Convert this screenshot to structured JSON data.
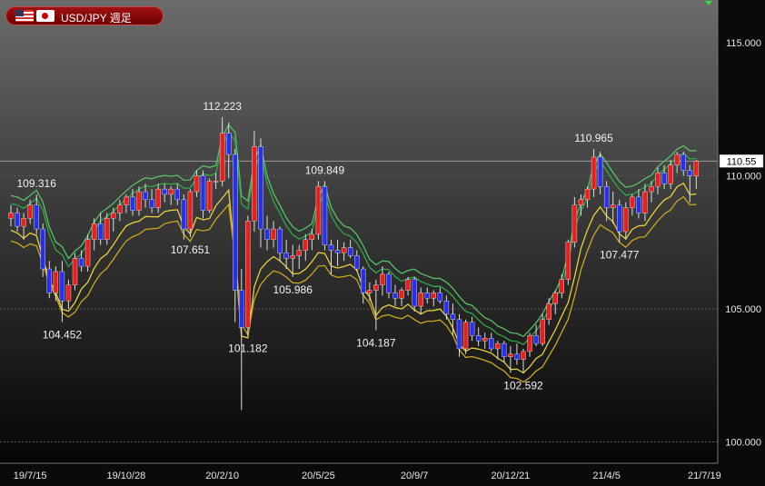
{
  "header": {
    "pair_label": "USD/JPY 週足"
  },
  "colors": {
    "up": "#ee1d1d",
    "down": "#2a2ef0",
    "ma_fast": "#e8d13a",
    "ma_slow": "#caa81e",
    "band_upper": "#2fa84a",
    "band_upper_light": "#58c067",
    "price_line": "#9a9a9a",
    "grid": "#5a5a5a"
  },
  "chart_data": {
    "type": "candlestick",
    "title": "USD/JPY 週足",
    "ylim": [
      99.2,
      116.6
    ],
    "y_ticks": [
      "115.000",
      "110.000",
      "105.000",
      "100.000"
    ],
    "x_labels": [
      {
        "label": "19/7/15",
        "index": 3
      },
      {
        "label": "19/10/28",
        "index": 18
      },
      {
        "label": "20/2/10",
        "index": 33
      },
      {
        "label": "20/5/25",
        "index": 48
      },
      {
        "label": "20/9/7",
        "index": 63
      },
      {
        "label": "20/12/21",
        "index": 78
      },
      {
        "label": "21/4/5",
        "index": 93
      },
      {
        "label": "21/7/19",
        "index": 108
      }
    ],
    "current_price": "110.55",
    "annotations": [
      {
        "text": "109.316",
        "index": 4,
        "value": 109.316,
        "pos": "above"
      },
      {
        "text": "104.452",
        "index": 8,
        "value": 104.452,
        "pos": "below"
      },
      {
        "text": "112.223",
        "index": 33,
        "value": 112.223,
        "pos": "above"
      },
      {
        "text": "107.651",
        "index": 28,
        "value": 107.651,
        "pos": "below"
      },
      {
        "text": "101.182",
        "index": 37,
        "value": 101.182,
        "pos": "below"
      },
      {
        "text": "109.849",
        "index": 49,
        "value": 109.849,
        "pos": "above"
      },
      {
        "text": "105.986",
        "index": 44,
        "value": 105.986,
        "pos": "below"
      },
      {
        "text": "104.187",
        "index": 57,
        "value": 104.187,
        "pos": "below"
      },
      {
        "text": "102.592",
        "index": 80,
        "value": 102.592,
        "pos": "below"
      },
      {
        "text": "110.965",
        "index": 91,
        "value": 110.965,
        "pos": "above"
      },
      {
        "text": "107.477",
        "index": 95,
        "value": 107.477,
        "pos": "below"
      }
    ],
    "candles": [
      [
        108.4,
        108.9,
        108.1,
        108.6
      ],
      [
        108.6,
        108.8,
        107.9,
        108.1
      ],
      [
        108.1,
        108.6,
        107.6,
        108.4
      ],
      [
        108.4,
        109.1,
        108.2,
        108.9
      ],
      [
        108.9,
        109.3,
        107.8,
        108.0
      ],
      [
        108.0,
        108.2,
        106.2,
        106.5
      ],
      [
        106.5,
        106.8,
        105.4,
        105.6
      ],
      [
        105.6,
        106.6,
        105.3,
        106.4
      ],
      [
        106.4,
        106.8,
        104.5,
        105.3
      ],
      [
        105.3,
        106.1,
        105.0,
        105.9
      ],
      [
        105.9,
        107.1,
        105.7,
        106.9
      ],
      [
        106.9,
        107.2,
        106.4,
        106.6
      ],
      [
        106.6,
        107.8,
        106.4,
        107.6
      ],
      [
        107.6,
        108.4,
        107.2,
        108.2
      ],
      [
        108.2,
        108.6,
        107.4,
        107.6
      ],
      [
        107.6,
        108.6,
        107.4,
        108.4
      ],
      [
        108.4,
        108.8,
        107.9,
        108.6
      ],
      [
        108.6,
        109.1,
        108.3,
        108.9
      ],
      [
        108.9,
        109.3,
        108.6,
        109.2
      ],
      [
        109.2,
        109.5,
        108.5,
        108.7
      ],
      [
        108.7,
        109.6,
        108.5,
        109.4
      ],
      [
        109.4,
        109.7,
        108.8,
        109.1
      ],
      [
        109.1,
        109.5,
        108.6,
        108.8
      ],
      [
        108.8,
        109.7,
        108.6,
        109.5
      ],
      [
        109.5,
        109.7,
        109.0,
        109.3
      ],
      [
        109.3,
        109.6,
        108.9,
        109.5
      ],
      [
        109.5,
        109.7,
        108.9,
        109.1
      ],
      [
        109.1,
        109.3,
        107.6,
        108.0
      ],
      [
        108.0,
        109.5,
        107.7,
        109.4
      ],
      [
        109.4,
        110.2,
        109.2,
        110.0
      ],
      [
        110.0,
        110.2,
        108.4,
        108.7
      ],
      [
        108.7,
        109.9,
        108.6,
        109.8
      ],
      [
        109.8,
        110.1,
        109.5,
        109.8
      ],
      [
        109.8,
        112.2,
        109.6,
        111.6
      ],
      [
        111.6,
        112.0,
        109.9,
        110.8
      ],
      [
        110.8,
        111.0,
        104.5,
        105.7
      ],
      [
        105.7,
        106.5,
        101.2,
        104.3
      ],
      [
        104.3,
        108.5,
        104.0,
        108.3
      ],
      [
        108.3,
        111.7,
        107.9,
        111.1
      ],
      [
        111.1,
        111.4,
        107.3,
        108.0
      ],
      [
        108.0,
        108.5,
        107.2,
        107.6
      ],
      [
        107.6,
        108.3,
        107.3,
        108.0
      ],
      [
        108.0,
        108.1,
        106.8,
        107.1
      ],
      [
        107.1,
        107.6,
        106.5,
        106.9
      ],
      [
        106.9,
        107.4,
        106.2,
        107.0
      ],
      [
        107.0,
        107.4,
        106.5,
        107.2
      ],
      [
        107.2,
        107.8,
        106.8,
        107.6
      ],
      [
        107.6,
        108.0,
        107.2,
        107.8
      ],
      [
        107.8,
        109.8,
        107.6,
        109.6
      ],
      [
        109.6,
        109.8,
        107.2,
        107.4
      ],
      [
        107.4,
        107.6,
        106.3,
        107.2
      ],
      [
        107.2,
        107.6,
        106.6,
        107.1
      ],
      [
        107.1,
        107.5,
        106.8,
        107.3
      ],
      [
        107.3,
        107.6,
        106.9,
        107.0
      ],
      [
        107.0,
        107.2,
        106.4,
        106.5
      ],
      [
        106.5,
        106.6,
        105.2,
        105.6
      ],
      [
        105.6,
        106.0,
        105.3,
        105.7
      ],
      [
        105.7,
        106.1,
        104.2,
        105.9
      ],
      [
        105.9,
        106.6,
        105.5,
        106.3
      ],
      [
        106.3,
        106.4,
        105.4,
        105.6
      ],
      [
        105.6,
        105.9,
        105.1,
        105.4
      ],
      [
        105.4,
        105.8,
        105.1,
        105.7
      ],
      [
        105.7,
        106.2,
        105.5,
        106.1
      ],
      [
        106.1,
        106.2,
        104.9,
        105.1
      ],
      [
        105.1,
        105.8,
        104.8,
        105.6
      ],
      [
        105.6,
        105.8,
        105.2,
        105.4
      ],
      [
        105.4,
        105.7,
        105.1,
        105.6
      ],
      [
        105.6,
        105.8,
        105.2,
        105.3
      ],
      [
        105.3,
        105.5,
        104.6,
        104.8
      ],
      [
        104.8,
        105.2,
        104.0,
        104.6
      ],
      [
        104.6,
        104.8,
        103.2,
        103.5
      ],
      [
        103.5,
        104.6,
        103.3,
        104.5
      ],
      [
        104.5,
        104.7,
        103.8,
        104.0
      ],
      [
        104.0,
        104.3,
        103.6,
        103.8
      ],
      [
        103.8,
        104.1,
        103.5,
        103.9
      ],
      [
        103.9,
        104.1,
        103.4,
        103.5
      ],
      [
        103.5,
        103.8,
        103.1,
        103.7
      ],
      [
        103.7,
        103.8,
        103.0,
        103.2
      ],
      [
        103.2,
        103.6,
        102.6,
        103.3
      ],
      [
        103.3,
        103.7,
        102.9,
        103.1
      ],
      [
        103.1,
        103.5,
        102.6,
        103.4
      ],
      [
        103.4,
        104.1,
        103.2,
        104.0
      ],
      [
        104.0,
        104.4,
        103.6,
        103.7
      ],
      [
        103.7,
        104.8,
        103.6,
        104.6
      ],
      [
        104.6,
        105.4,
        104.4,
        105.2
      ],
      [
        105.2,
        105.7,
        104.8,
        105.6
      ],
      [
        105.6,
        106.3,
        105.4,
        106.1
      ],
      [
        106.1,
        107.6,
        105.9,
        107.5
      ],
      [
        107.5,
        109.2,
        107.3,
        108.9
      ],
      [
        108.9,
        109.3,
        108.5,
        109.1
      ],
      [
        109.1,
        109.6,
        108.8,
        109.5
      ],
      [
        109.5,
        111.0,
        109.2,
        110.7
      ],
      [
        110.7,
        110.9,
        109.3,
        109.6
      ],
      [
        109.6,
        109.8,
        108.3,
        108.8
      ],
      [
        108.8,
        109.4,
        108.2,
        108.9
      ],
      [
        108.9,
        109.1,
        107.5,
        107.9
      ],
      [
        107.9,
        109.0,
        107.6,
        108.8
      ],
      [
        108.8,
        109.3,
        108.5,
        109.2
      ],
      [
        109.2,
        109.5,
        108.4,
        108.6
      ],
      [
        108.6,
        109.7,
        108.3,
        109.4
      ],
      [
        109.4,
        109.8,
        109.0,
        109.6
      ],
      [
        109.6,
        110.3,
        109.3,
        110.1
      ],
      [
        110.1,
        110.4,
        109.5,
        109.7
      ],
      [
        109.7,
        110.6,
        109.5,
        110.4
      ],
      [
        110.4,
        110.9,
        110.1,
        110.8
      ],
      [
        110.8,
        110.9,
        110.0,
        110.2
      ],
      [
        110.2,
        110.4,
        109.0,
        110.0
      ],
      [
        110.0,
        110.6,
        109.5,
        110.55
      ]
    ]
  }
}
